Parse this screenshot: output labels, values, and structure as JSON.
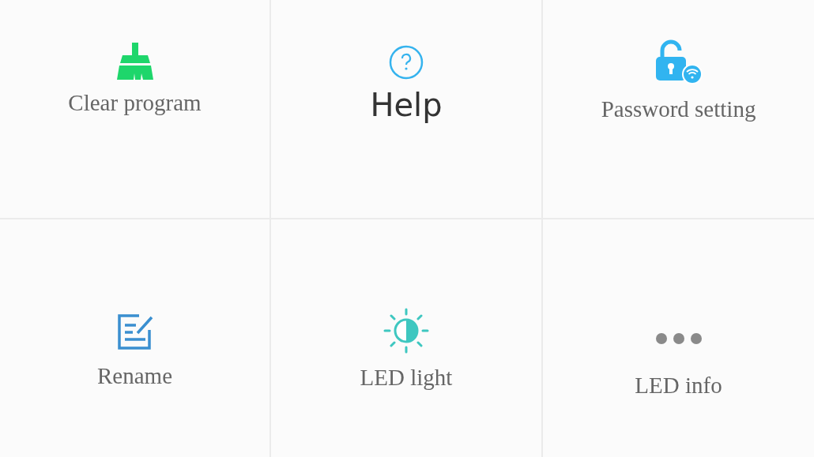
{
  "tiles": [
    {
      "kind": "clear",
      "label": "Clear program"
    },
    {
      "kind": "help",
      "label": "Help"
    },
    {
      "kind": "password",
      "label": "Password setting"
    },
    {
      "kind": "rename",
      "label": "Rename"
    },
    {
      "kind": "led",
      "label": "LED light"
    },
    {
      "kind": "more",
      "label": "LED info"
    }
  ]
}
